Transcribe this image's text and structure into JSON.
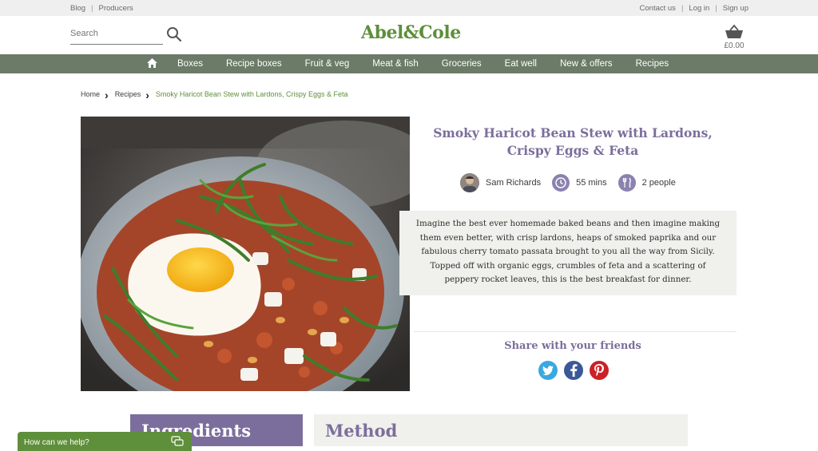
{
  "topbar": {
    "left_links": [
      "Blog",
      "Producers"
    ],
    "right_links": [
      "Contact us",
      "Log in",
      "Sign up"
    ]
  },
  "header": {
    "search_placeholder": "Search",
    "logo_text": "Abel&Cole",
    "basket_total": "£0.00"
  },
  "nav": {
    "items": [
      "Boxes",
      "Recipe boxes",
      "Fruit & veg",
      "Meat & fish",
      "Groceries",
      "Eat well",
      "New & offers",
      "Recipes"
    ]
  },
  "breadcrumb": {
    "home": "Home",
    "recipes": "Recipes",
    "current": "Smoky Haricot Bean Stew with Lardons, Crispy Eggs & Feta"
  },
  "recipe": {
    "title_line1": "Smoky Haricot Bean Stew with Lardons,",
    "title_line2": "Crispy Eggs & Feta",
    "author": "Sam Richards",
    "time": "55 mins",
    "serves": "2 people",
    "description": "Imagine the best ever homemade baked beans and then imagine making them even better, with crisp lardons, heaps of smoked paprika and our fabulous cherry tomato passata brought to you all the way from Sicily. Topped off with organic eggs, crumbles of feta and a scattering of peppery rocket leaves, this is the best breakfast for dinner."
  },
  "share": {
    "title": "Share with your friends",
    "icons": [
      "twitter-icon",
      "facebook-icon",
      "pinterest-icon"
    ]
  },
  "sections": {
    "ingredients": "Ingredients",
    "method": "Method"
  },
  "help": {
    "label": "How can we help?"
  },
  "colors": {
    "brand_green": "#5e8f3a",
    "nav_bg": "#6b7b67",
    "accent_purple": "#7c6e9c",
    "panel_bg": "#f0f0ec"
  }
}
